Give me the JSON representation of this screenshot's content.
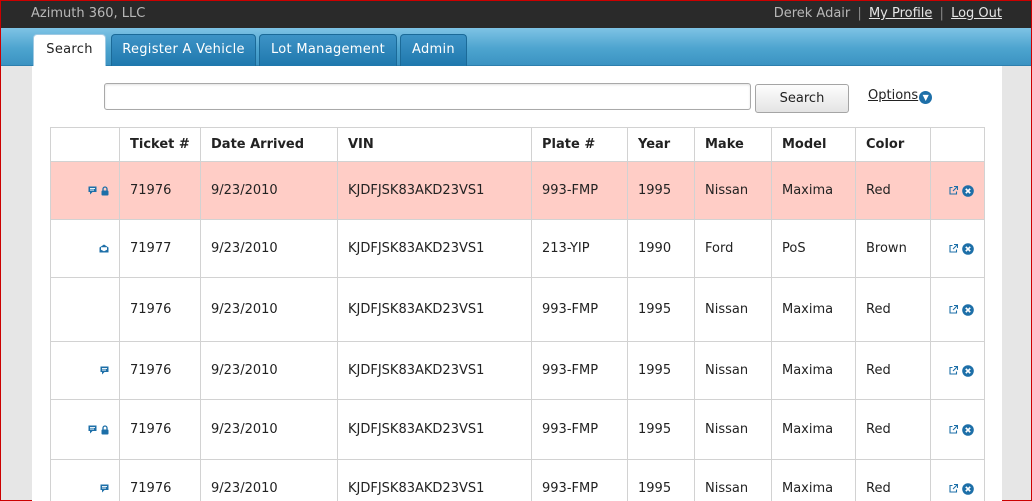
{
  "header": {
    "company": "Azimuth 360, LLC",
    "user_name": "Derek Adair",
    "my_profile": "My Profile",
    "log_out": "Log Out",
    "separator": "|"
  },
  "tabs": [
    {
      "label": "Search",
      "active": true
    },
    {
      "label": "Register A Vehicle",
      "active": false
    },
    {
      "label": "Lot Management",
      "active": false
    },
    {
      "label": "Admin",
      "active": false
    }
  ],
  "search": {
    "value": "",
    "placeholder": "",
    "button_label": "Search",
    "options_label": "Options"
  },
  "table": {
    "columns": [
      "",
      "Ticket #",
      "Date Arrived",
      "VIN",
      "Plate #",
      "Year",
      "Make",
      "Model",
      "Color",
      ""
    ],
    "rows": [
      {
        "ticket": "71976",
        "date": "9/23/2010",
        "vin": "KJDFJSK83AKD23VS1",
        "plate": "993-FMP",
        "year": "1995",
        "make": "Nissan",
        "model": "Maxima",
        "color": "Red",
        "status_icons": [
          "comment-icon",
          "lock-icon"
        ],
        "highlight": true
      },
      {
        "ticket": "71977",
        "date": "9/23/2010",
        "vin": "KJDFJSK83AKD23VS1",
        "plate": "213-YIP",
        "year": "1990",
        "make": "Ford",
        "model": "PoS",
        "color": "Brown",
        "status_icons": [
          "mail-icon"
        ],
        "highlight": false
      },
      {
        "ticket": "71976",
        "date": "9/23/2010",
        "vin": "KJDFJSK83AKD23VS1",
        "plate": "993-FMP",
        "year": "1995",
        "make": "Nissan",
        "model": "Maxima",
        "color": "Red",
        "status_icons": [],
        "highlight": false
      },
      {
        "ticket": "71976",
        "date": "9/23/2010",
        "vin": "KJDFJSK83AKD23VS1",
        "plate": "993-FMP",
        "year": "1995",
        "make": "Nissan",
        "model": "Maxima",
        "color": "Red",
        "status_icons": [
          "comment-icon"
        ],
        "highlight": false
      },
      {
        "ticket": "71976",
        "date": "9/23/2010",
        "vin": "KJDFJSK83AKD23VS1",
        "plate": "993-FMP",
        "year": "1995",
        "make": "Nissan",
        "model": "Maxima",
        "color": "Red",
        "status_icons": [
          "comment-icon",
          "lock-icon"
        ],
        "highlight": false
      },
      {
        "ticket": "71976",
        "date": "9/23/2010",
        "vin": "KJDFJSK83AKD23VS1",
        "plate": "993-FMP",
        "year": "1995",
        "make": "Nissan",
        "model": "Maxima",
        "color": "Red",
        "status_icons": [
          "comment-icon"
        ],
        "highlight": false
      }
    ],
    "row_action_icons": [
      "external-link-icon",
      "delete-icon"
    ]
  },
  "colors": {
    "topbar": "#2a2a2a",
    "tab_blue": "#1f78ad",
    "highlight_row": "#ffcdc6",
    "icon_blue": "#1d6fa8"
  }
}
